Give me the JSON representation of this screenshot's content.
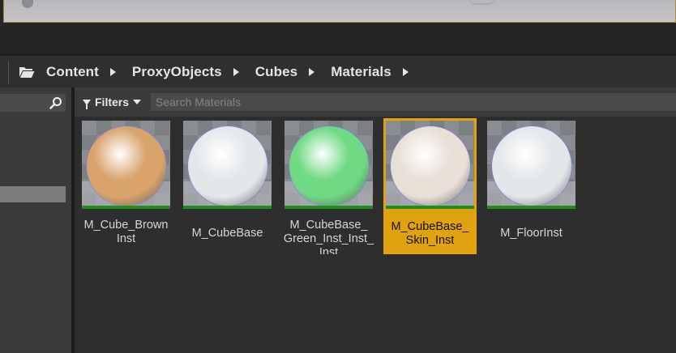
{
  "breadcrumb": {
    "items": [
      "Content",
      "ProxyObjects",
      "Cubes",
      "Materials"
    ]
  },
  "filters": {
    "label": "Filters"
  },
  "search": {
    "placeholder": "Search Materials"
  },
  "assets": [
    {
      "label": "M_Cube_Brown\nInst",
      "selected": false,
      "color": "#d9a36c"
    },
    {
      "label": "M_CubeBase",
      "selected": false,
      "color": "#e4e7ea"
    },
    {
      "label": "M_CubeBase_\nGreen_Inst_Inst_\nInst",
      "selected": false,
      "color": "#6fd983"
    },
    {
      "label": "M_CubeBase_\nSkin_Inst",
      "selected": true,
      "color": "#e8e0d6"
    },
    {
      "label": "M_FloorInst",
      "selected": false,
      "color": "#e4e7ea"
    }
  ],
  "colors": {
    "selection": "#e0a20f",
    "accent_green": "#1c8f1c"
  }
}
